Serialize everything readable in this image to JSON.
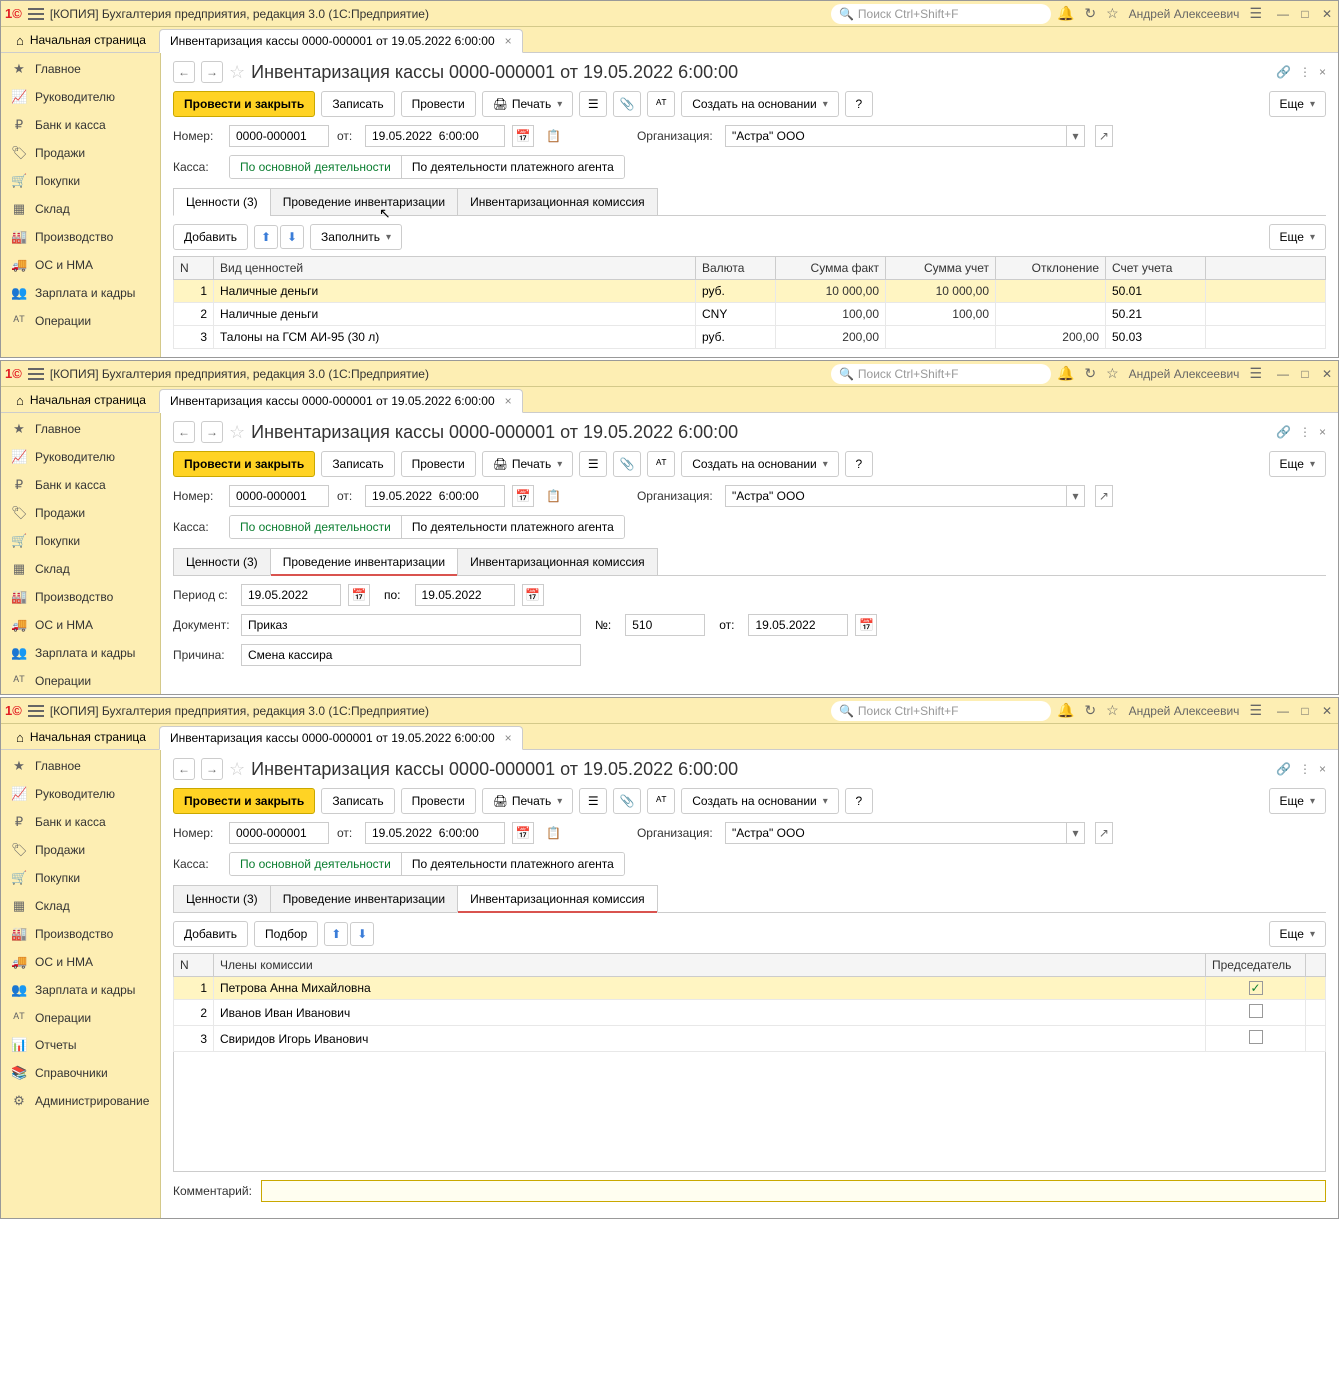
{
  "app": {
    "title": "[КОПИЯ] Бухгалтерия предприятия, редакция 3.0  (1С:Предприятие)",
    "search_ph": "Поиск Ctrl+Shift+F",
    "user": "Андрей Алексеевич"
  },
  "tabs": {
    "home": "Начальная страница",
    "doc": "Инвентаризация кассы 0000-000001 от 19.05.2022 6:00:00"
  },
  "sidebar": [
    "Главное",
    "Руководителю",
    "Банк и касса",
    "Продажи",
    "Покупки",
    "Склад",
    "Производство",
    "ОС и НМА",
    "Зарплата и кадры",
    "Операции",
    "Отчеты",
    "Справочники",
    "Администрирование"
  ],
  "side_icons": [
    "★",
    "📈",
    "₽",
    "🏷",
    "🛒",
    "▦",
    "🏭",
    "🚚",
    "👥",
    "ᴬᵀ",
    "📊",
    "📚",
    "⚙"
  ],
  "page": {
    "title": "Инвентаризация кассы 0000-000001 от 19.05.2022 6:00:00"
  },
  "toolbar": {
    "primary": "Провести и закрыть",
    "save": "Записать",
    "post": "Провести",
    "print": "Печать",
    "create_based": "Создать на основании",
    "more": "Еще"
  },
  "form": {
    "num_lbl": "Номер:",
    "num": "0000-000001",
    "from_lbl": "от:",
    "date": "19.05.2022  6:00:00",
    "org_lbl": "Организация:",
    "org": "\"Астра\" ООО",
    "cash_lbl": "Касса:",
    "main_act": "По основной деятельности",
    "agent_act": "По деятельности платежного агента"
  },
  "subtabs": {
    "values": "Ценности (3)",
    "proc": "Проведение инвентаризации",
    "comm": "Инвентаризационная комиссия"
  },
  "values_tb": {
    "add": "Добавить",
    "fill": "Заполнить",
    "more": "Еще"
  },
  "values_cols": {
    "n": "N",
    "type": "Вид ценностей",
    "cur": "Валюта",
    "fact": "Сумма факт",
    "acc_sum": "Сумма учет",
    "dev": "Отклонение",
    "account": "Счет учета"
  },
  "values_rows": [
    {
      "n": "1",
      "type": "Наличные деньги",
      "cur": "руб.",
      "fact": "10 000,00",
      "acc": "10 000,00",
      "dev": "",
      "account": "50.01"
    },
    {
      "n": "2",
      "type": "Наличные деньги",
      "cur": "CNY",
      "fact": "100,00",
      "acc": "100,00",
      "dev": "",
      "account": "50.21"
    },
    {
      "n": "3",
      "type": "Талоны на ГСМ АИ-95 (30 л)",
      "cur": "руб.",
      "fact": "200,00",
      "acc": "",
      "dev": "200,00",
      "account": "50.03"
    }
  ],
  "proc": {
    "period_from_lbl": "Период с:",
    "period_from": "19.05.2022",
    "period_to_lbl": "по:",
    "period_to": "19.05.2022",
    "doc_lbl": "Документ:",
    "doc": "Приказ",
    "num_lbl": "№:",
    "num": "510",
    "from_lbl": "от:",
    "from": "19.05.2022",
    "reason_lbl": "Причина:",
    "reason": "Смена кассира"
  },
  "comm_tb": {
    "add": "Добавить",
    "pick": "Подбор",
    "more": "Еще"
  },
  "comm_cols": {
    "n": "N",
    "member": "Члены комиссии",
    "chair": "Председатель"
  },
  "comm_rows": [
    {
      "n": "1",
      "name": "Петрова Анна Михайловна",
      "chair": true
    },
    {
      "n": "2",
      "name": "Иванов Иван Иванович",
      "chair": false
    },
    {
      "n": "3",
      "name": "Свиридов Игорь Иванович",
      "chair": false
    }
  ],
  "comment_lbl": "Комментарий:"
}
